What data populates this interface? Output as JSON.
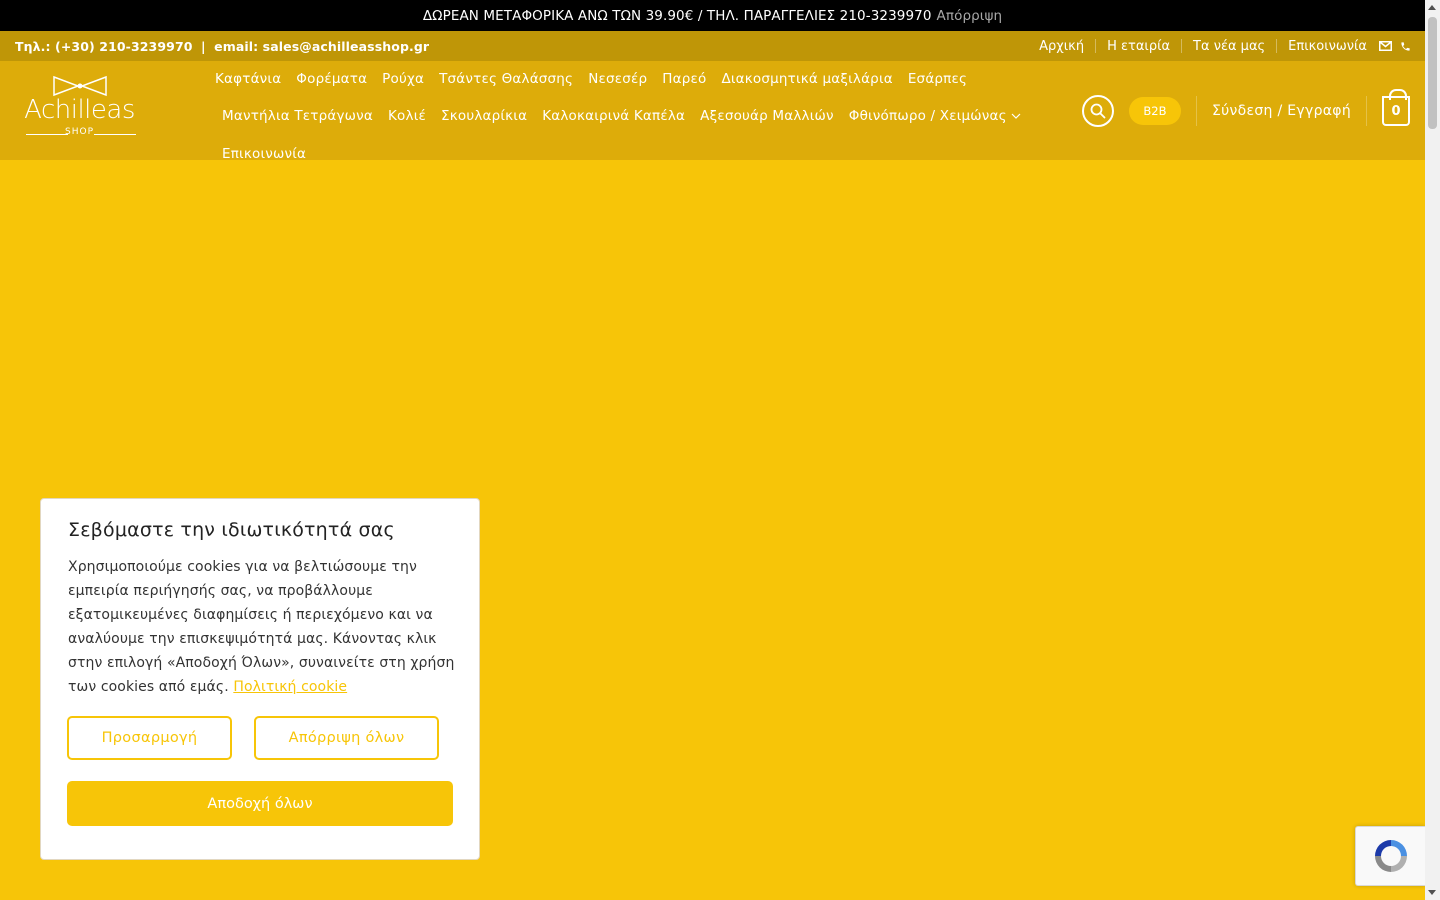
{
  "notice": {
    "text": "ΔΩΡΕΑΝ ΜΕΤΑΦΟΡΙΚΑ ΑΝΩ ΤΩΝ 39.90€ / ΤΗΛ. ΠΑΡΑΓΓΕΛΙΕΣ 210-3239970",
    "dismiss_label": "Απόρριψη"
  },
  "contact": {
    "phone": "Τηλ.: (+30) 210-3239970",
    "separator": "|",
    "email": "email: sales@achilleasshop.gr"
  },
  "top_links": [
    "Αρχική",
    "Η εταιρία",
    "Τα νέα μας",
    "Επικοινωνία"
  ],
  "logo": {
    "name": "Achilleas",
    "sub": "SHOP"
  },
  "nav": {
    "row1": [
      "Καφτάνια",
      "Φορέματα",
      "Ρούχα",
      "Τσάντες Θαλάσσης",
      "Νεσεσέρ",
      "Παρεό",
      "Διακοσμητικά μαξιλάρια",
      "Εσάρπες"
    ],
    "row2": [
      "Μαντήλια Τετράγωνα",
      "Κολιέ",
      "Σκουλαρίκια",
      "Καλοκαιρινά Καπέλα",
      "Αξεσουάρ Μαλλιών",
      "Φθινόπωρο / Χειμώνας"
    ],
    "row3": [
      "Επικοινωνία"
    ]
  },
  "header_tools": {
    "b2b_label": "B2B",
    "login_label": "Σύνδεση / Εγγραφή",
    "cart_count": "0"
  },
  "cookie": {
    "title": "Σεβόμαστε την ιδιωτικότητά σας",
    "body": "Χρησιμοποιούμε cookies για να βελτιώσουμε την εμπειρία περιήγησής σας, να προβάλλουμε εξατομικευμένες διαφημίσεις ή περιεχόμενο και να αναλύουμε την επισκεψιμότητά μας. Κάνοντας κλικ στην επιλογή «Αποδοχή Όλων», συναινείτε στη χρήση των cookies από εμάς.",
    "policy_link": "Πολιτική cookie",
    "customize_label": "Προσαρμογή",
    "reject_label": "Απόρριψη όλων",
    "accept_label": "Αποδοχή όλων"
  },
  "colors": {
    "brand_yellow": "#f7c508",
    "header_gold": "#ddac0a",
    "contact_bar": "#bf9607",
    "notice_bar": "#000000"
  }
}
